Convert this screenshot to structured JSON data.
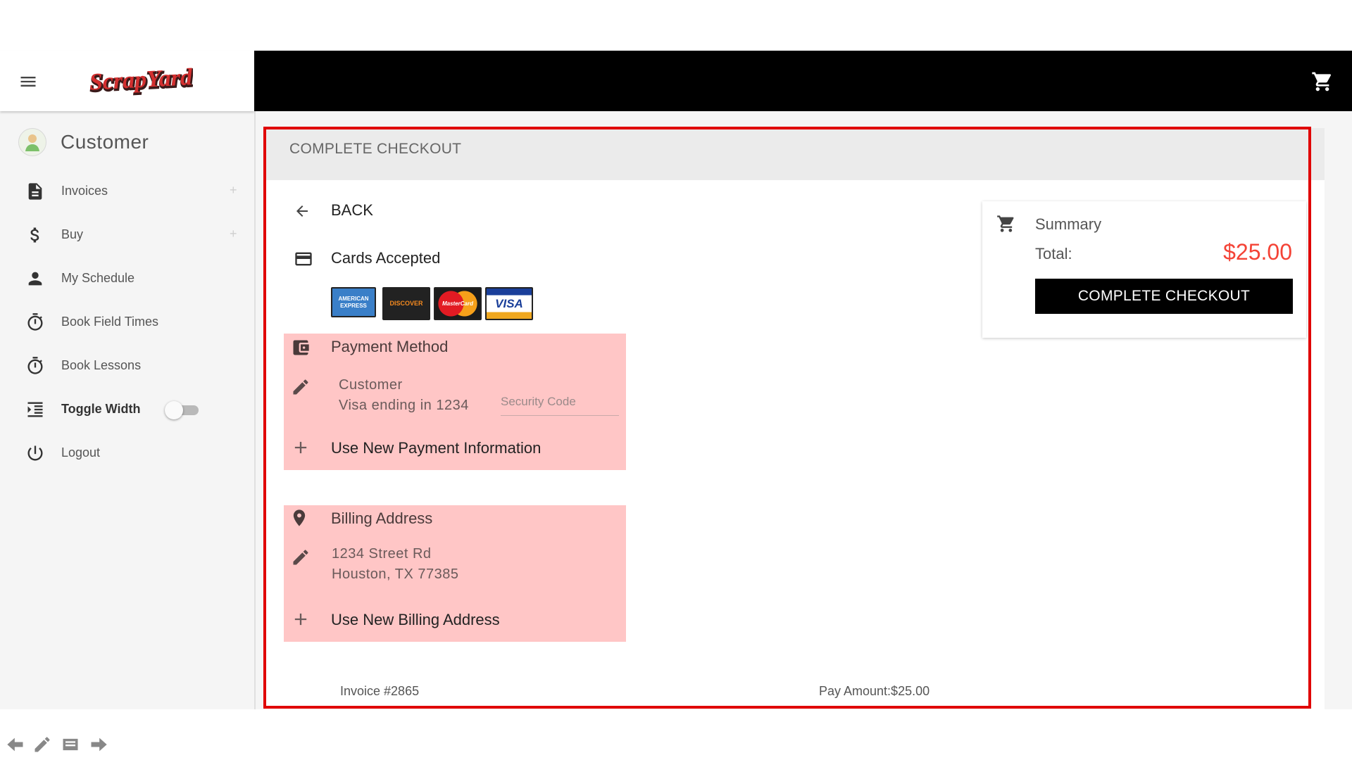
{
  "sidebar": {
    "user_name": "Customer",
    "items": [
      {
        "label": "Invoices",
        "plus": "+"
      },
      {
        "label": "Buy",
        "plus": "+"
      },
      {
        "label": "My Schedule"
      },
      {
        "label": "Book Field Times"
      },
      {
        "label": "Book Lessons"
      },
      {
        "label": "Toggle Width"
      },
      {
        "label": "Logout"
      }
    ]
  },
  "brand": {
    "logo_text": "ScrapYard",
    "colors": {
      "red": "#d32f2f",
      "dark": "#3a1a1a"
    }
  },
  "topbar": {
    "cart_icon": "cart-icon"
  },
  "page": {
    "title": "COMPLETE CHECKOUT",
    "back_label": "BACK",
    "cards_accepted_label": "Cards Accepted",
    "cards": [
      {
        "name": "AMERICAN EXPRESS",
        "short": "AMERICAN EXPRESS"
      },
      {
        "name": "DISCOVER",
        "short": "DISCOVER"
      },
      {
        "name": "MasterCard",
        "short": "MasterCard"
      },
      {
        "name": "VISA",
        "short": "VISA"
      }
    ],
    "payment": {
      "title": "Payment Method",
      "name": "Customer",
      "card": "Visa ending in 1234",
      "security_placeholder": "Security Code",
      "security_value": "",
      "new_label": "Use New Payment Information"
    },
    "billing": {
      "title": "Billing Address",
      "line1": "1234 Street Rd",
      "line2": "Houston, TX 77385",
      "new_label": "Use New Billing Address"
    },
    "summary": {
      "title": "Summary",
      "total_label": "Total:",
      "total_value": "$25.00",
      "total_color": "#f44336",
      "button_label": "COMPLETE CHECKOUT"
    },
    "footer": {
      "invoice": "Invoice #2865",
      "pay_amount": "Pay Amount:$25.00"
    }
  },
  "colors": {
    "highlight": "#e00000",
    "pink_box": "#ffc6c6",
    "topbar": "#000000"
  }
}
